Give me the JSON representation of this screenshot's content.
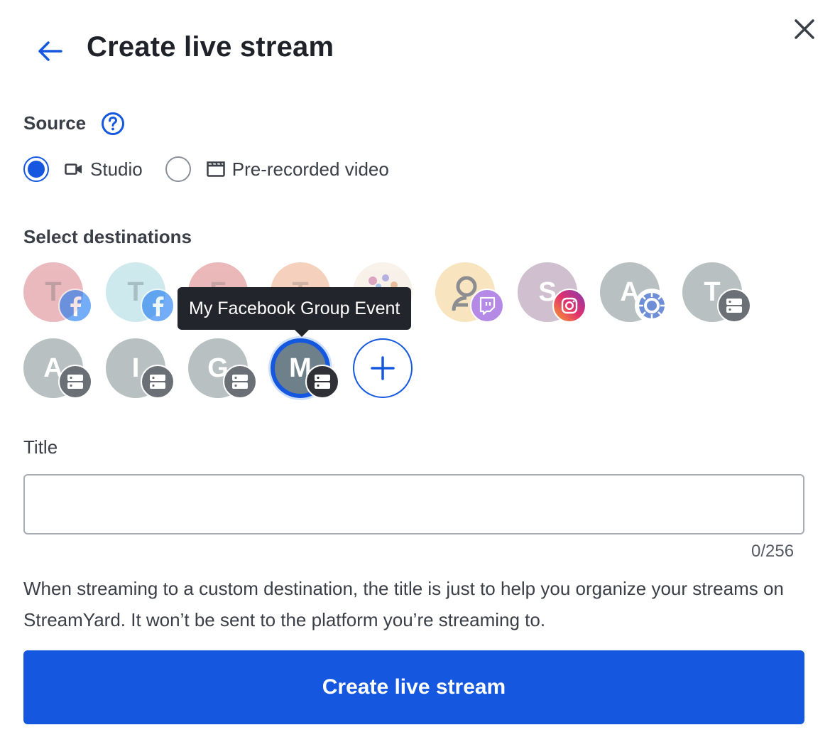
{
  "header": {
    "title": "Create live stream"
  },
  "source": {
    "label": "Source",
    "options": [
      {
        "label": "Studio",
        "selected": true,
        "icon": "video-camera-icon"
      },
      {
        "label": "Pre-recorded video",
        "selected": false,
        "icon": "clapperboard-icon"
      }
    ]
  },
  "destinations": {
    "label": "Select destinations",
    "row1_letters": [
      "T",
      "T",
      "F",
      "T",
      "",
      "",
      "S",
      "A",
      "T"
    ],
    "row2_letters": [
      "A",
      "I",
      "G",
      "M"
    ],
    "tooltip": "My Facebook Group Event"
  },
  "title_field": {
    "label": "Title",
    "value": "",
    "counter": "0/256"
  },
  "help_text": "When streaming to a custom destination, the title is just to help you organize your streams on StreamYard. It won’t be sent to the platform you’re streaming to.",
  "submit": {
    "label": "Create live stream"
  },
  "colors": {
    "accent": "#1558df",
    "facebook": "#1877f2",
    "twitch": "#9146ff",
    "server_badge": "#6b6f76"
  }
}
